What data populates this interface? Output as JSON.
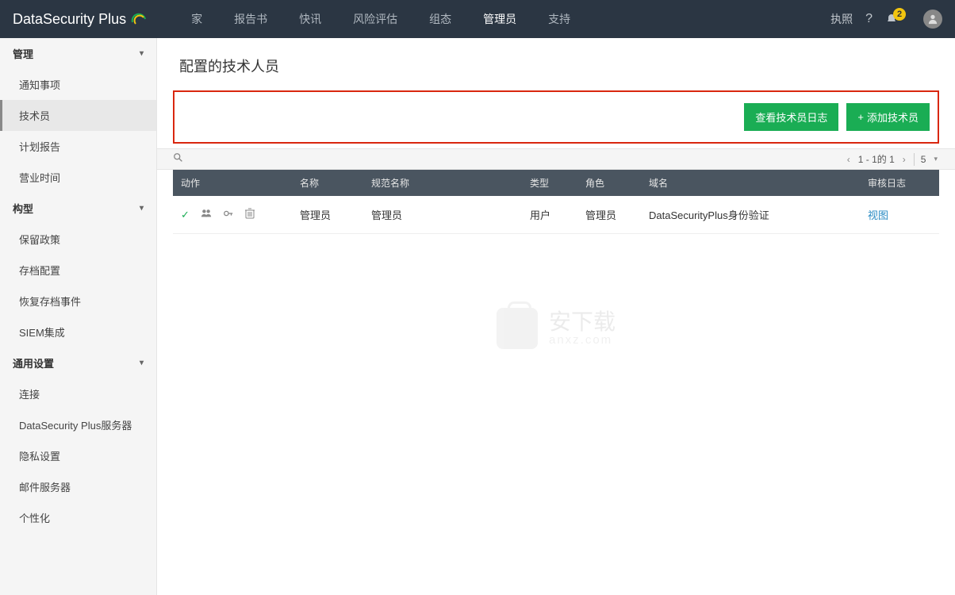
{
  "brand": {
    "name": "DataSecurity",
    "suffix": "Plus"
  },
  "nav": {
    "items": [
      {
        "label": "家"
      },
      {
        "label": "报告书"
      },
      {
        "label": "快讯"
      },
      {
        "label": "风险评估"
      },
      {
        "label": "组态"
      },
      {
        "label": "管理员",
        "active": true
      },
      {
        "label": "支持"
      }
    ]
  },
  "topbar_right": {
    "license": "执照",
    "help": "?",
    "notification_count": "2"
  },
  "sidebar": {
    "sections": [
      {
        "title": "管理",
        "items": [
          {
            "label": "通知事项"
          },
          {
            "label": "技术员",
            "active": true
          },
          {
            "label": "计划报告"
          },
          {
            "label": "营业时间"
          }
        ]
      },
      {
        "title": "构型",
        "items": [
          {
            "label": "保留政策"
          },
          {
            "label": "存档配置"
          },
          {
            "label": "恢复存档事件"
          },
          {
            "label": "SIEM集成"
          }
        ]
      },
      {
        "title": "通用设置",
        "items": [
          {
            "label": "连接"
          },
          {
            "label": "DataSecurity Plus服务器"
          },
          {
            "label": "隐私设置"
          },
          {
            "label": "邮件服务器"
          },
          {
            "label": "个性化"
          }
        ]
      }
    ]
  },
  "page": {
    "title": "配置的技术人员"
  },
  "actions": {
    "view_log": "查看技术员日志",
    "add": "添加技术员"
  },
  "pager": {
    "range": "1 - 1的 1",
    "pagesize": "5"
  },
  "table": {
    "headers": {
      "action": "动作",
      "name": "名称",
      "spec_name": "规范名称",
      "type": "类型",
      "role": "角色",
      "domain": "域名",
      "audit": "审核日志"
    },
    "rows": [
      {
        "name": "管理员",
        "spec_name": "管理员",
        "type": "用户",
        "role": "管理员",
        "domain": "DataSecurityPlus身份验证",
        "audit": "视图"
      }
    ]
  },
  "watermark": {
    "main": "安下载",
    "sub": "anxz.com"
  }
}
